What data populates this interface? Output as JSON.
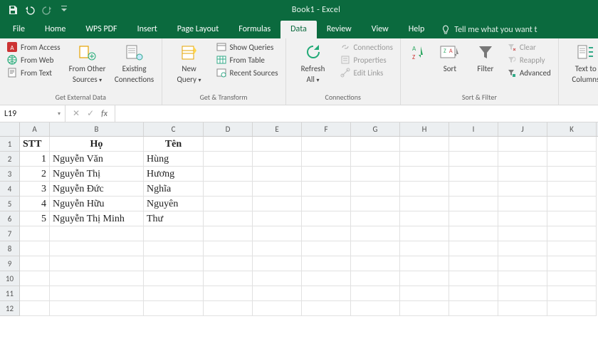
{
  "app": {
    "title": "Book1 - Excel"
  },
  "tabs": {
    "file": "File",
    "home": "Home",
    "wpspdf": "WPS PDF",
    "insert": "Insert",
    "pagelayout": "Page Layout",
    "formulas": "Formulas",
    "data": "Data",
    "review": "Review",
    "view": "View",
    "help": "Help",
    "tellme": "Tell me what you want t"
  },
  "ribbon": {
    "get_ext": {
      "label": "Get External Data",
      "from_access": "From Access",
      "from_web": "From Web",
      "from_text": "From Text",
      "from_other": "From Other",
      "from_other2": "Sources",
      "existing": "Existing",
      "existing2": "Connections"
    },
    "get_trans": {
      "label": "Get & Transform",
      "new_query": "New",
      "new_query2": "Query",
      "show_q": "Show Queries",
      "from_table": "From Table",
      "recent": "Recent Sources"
    },
    "conns": {
      "label": "Connections",
      "refresh": "Refresh",
      "refresh2": "All",
      "connections": "Connections",
      "properties": "Properties",
      "edit_links": "Edit Links"
    },
    "sort_filter": {
      "label": "Sort & Filter",
      "sort": "Sort",
      "filter": "Filter",
      "clear": "Clear",
      "reapply": "Reapply",
      "advanced": "Advanced"
    },
    "tools": {
      "text_to": "Text to",
      "columns": "Columns"
    }
  },
  "formula_bar": {
    "namebox": "L19",
    "fx": "fx"
  },
  "grid": {
    "cols": [
      "A",
      "B",
      "C",
      "D",
      "E",
      "F",
      "G",
      "H",
      "I",
      "J",
      "K"
    ],
    "row_count": 12,
    "header": {
      "a": "STT",
      "b": "Họ",
      "c": "Tên"
    },
    "data": [
      {
        "stt": "1",
        "ho": "Nguyễn Văn",
        "ten": "Hùng"
      },
      {
        "stt": "2",
        "ho": "Nguyễn Thị",
        "ten": "Hương"
      },
      {
        "stt": "3",
        "ho": "Nguyễn Đức",
        "ten": "Nghĩa"
      },
      {
        "stt": "4",
        "ho": "Nguyễn Hữu",
        "ten": "Nguyên"
      },
      {
        "stt": "5",
        "ho": "Nguyễn Thị Minh",
        "ten": "Thư"
      }
    ]
  }
}
